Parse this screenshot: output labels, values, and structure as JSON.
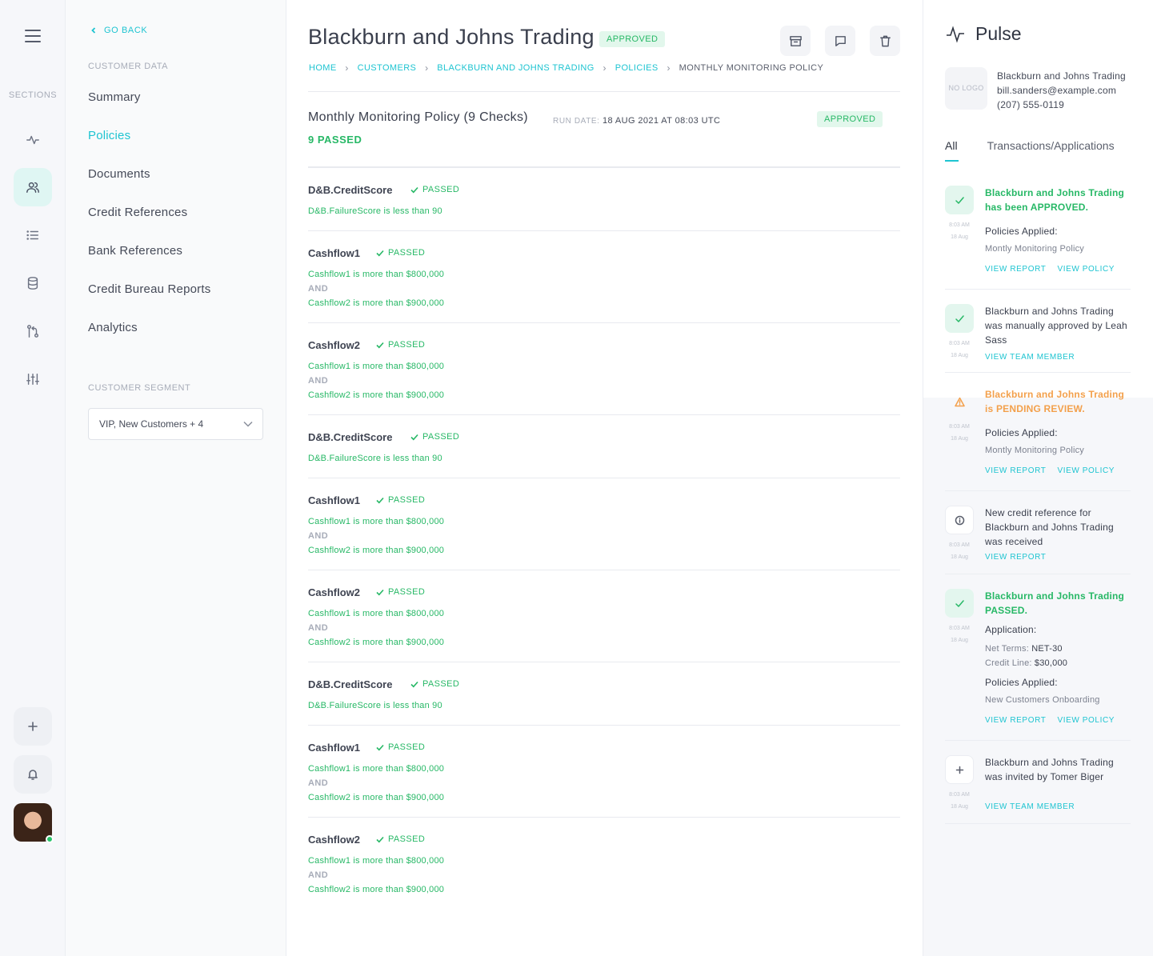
{
  "rail": {
    "sections_label": "SECTIONS"
  },
  "sidebar": {
    "go_back": "GO BACK",
    "customer_data_title": "CUSTOMER DATA",
    "items": [
      {
        "label": "Summary"
      },
      {
        "label": "Policies"
      },
      {
        "label": "Documents"
      },
      {
        "label": "Credit References"
      },
      {
        "label": "Bank References"
      },
      {
        "label": "Credit Bureau Reports"
      },
      {
        "label": "Analytics"
      }
    ],
    "active_item": "Policies",
    "segment_title": "CUSTOMER SEGMENT",
    "segment_value": "VIP, New Customers + 4"
  },
  "header": {
    "title": "Blackburn and Johns Trading",
    "status_badge": "APPROVED",
    "breadcrumb": [
      "HOME",
      "CUSTOMERS",
      "BLACKBURN AND JOHNS TRADING",
      "POLICIES",
      "MONTHLY MONITORING POLICY"
    ]
  },
  "policy": {
    "name": "Monthly Monitoring Policy (9 Checks)",
    "run_label": "RUN DATE:",
    "run_date": "18 AUG 2021 AT 08:03 UTC",
    "status": "APPROVED",
    "passed_summary": "9 PASSED",
    "checks": [
      {
        "name": "D&B.CreditScore",
        "status": "PASSED",
        "conditions": [
          "D&B.FailureScore is less than 90"
        ]
      },
      {
        "name": "Cashflow1",
        "status": "PASSED",
        "conditions": [
          "Cashflow1 is more than $800,000",
          "Cashflow2 is more than $900,000"
        ]
      },
      {
        "name": "Cashflow2",
        "status": "PASSED",
        "conditions": [
          "Cashflow1 is more than $800,000",
          "Cashflow2 is more than $900,000"
        ]
      },
      {
        "name": "D&B.CreditScore",
        "status": "PASSED",
        "conditions": [
          "D&B.FailureScore is less than 90"
        ]
      },
      {
        "name": "Cashflow1",
        "status": "PASSED",
        "conditions": [
          "Cashflow1 is more than $800,000",
          "Cashflow2 is more than $900,000"
        ]
      },
      {
        "name": "Cashflow2",
        "status": "PASSED",
        "conditions": [
          "Cashflow1 is more than $800,000",
          "Cashflow2 is more than $900,000"
        ]
      },
      {
        "name": "D&B.CreditScore",
        "status": "PASSED",
        "conditions": [
          "D&B.FailureScore is less than 90"
        ]
      },
      {
        "name": "Cashflow1",
        "status": "PASSED",
        "conditions": [
          "Cashflow1 is more than $800,000",
          "Cashflow2 is more than $900,000"
        ]
      },
      {
        "name": "Cashflow2",
        "status": "PASSED",
        "conditions": [
          "Cashflow1 is more than $800,000",
          "Cashflow2 is more than $900,000"
        ]
      }
    ],
    "and_label": "AND"
  },
  "pulse": {
    "title": "Pulse",
    "logo_placeholder": "NO LOGO",
    "customer_name": "Blackburn and Johns Trading",
    "customer_email": "bill.sanders@example.com",
    "customer_phone": "(207) 555-0119",
    "tabs": [
      "All",
      "Transactions/Applications"
    ],
    "active_tab": "All",
    "feed": [
      {
        "icon": "check-icon",
        "tone": "green",
        "time": "8:03 AM",
        "date": "18 Aug",
        "headline": "Blackburn and Johns Trading has been APPROVED.",
        "policies_label": "Policies Applied:",
        "policy": "Montly Monitoring Policy",
        "links": [
          "VIEW REPORT",
          "VIEW POLICY"
        ]
      },
      {
        "icon": "check-icon",
        "tone": "green",
        "time": "8:03 AM",
        "date": "18 Aug",
        "text": "Blackburn and Johns Trading was manually approved by Leah Sass",
        "links": [
          "VIEW TEAM MEMBER"
        ]
      },
      {
        "icon": "warning-icon",
        "tone": "orange",
        "time": "8:03 AM",
        "date": "18 Aug",
        "headline": "Blackburn and Johns Trading is PENDING REVIEW.",
        "policies_label": "Policies Applied:",
        "policy": "Montly Monitoring Policy",
        "links": [
          "VIEW REPORT",
          "VIEW POLICY"
        ]
      },
      {
        "icon": "info-icon",
        "tone": "plain",
        "time": "8:03 AM",
        "date": "18 Aug",
        "text": "New credit reference for Blackburn and Johns Trading was received",
        "links": [
          "VIEW REPORT"
        ]
      },
      {
        "icon": "check-icon",
        "tone": "green",
        "time": "8:03 AM",
        "date": "18 Aug",
        "headline": "Blackburn and Johns Trading PASSED.",
        "application_label": "Application:",
        "net_terms_label": "Net Terms:",
        "net_terms": "NET-30",
        "credit_line_label": "Credit Line:",
        "credit_line": "$30,000",
        "policies_label": "Policies Applied:",
        "policy": "New Customers Onboarding",
        "links": [
          "VIEW REPORT",
          "VIEW POLICY"
        ]
      },
      {
        "icon": "plus-icon",
        "tone": "plain",
        "time": "8:03 AM",
        "date": "18 Aug",
        "text": "Blackburn and Johns Trading was invited by Tomer Biger",
        "links": [
          "VIEW TEAM MEMBER"
        ]
      }
    ]
  },
  "colors": {
    "accent": "#1ec4d1",
    "success": "#27b866",
    "warning": "#f3a04b"
  }
}
